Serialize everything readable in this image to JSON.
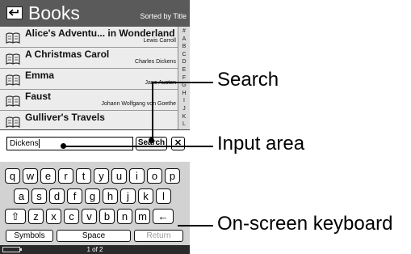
{
  "header": {
    "back_icon": "back-arrow-icon",
    "title": "Books",
    "sort_label": "Sorted by Title"
  },
  "books": [
    {
      "title": "Alice's Adventu... in Wonderland",
      "author": "Lewis Carroll"
    },
    {
      "title": "A Christmas Carol",
      "author": "Charles Dickens"
    },
    {
      "title": "Emma",
      "author": "Jane Austen"
    },
    {
      "title": "Faust",
      "author": "Johann Wolfgang von Goethe"
    },
    {
      "title": "Gulliver's Travels",
      "author": ""
    }
  ],
  "alphabet_index": [
    "#",
    "A",
    "B",
    "C",
    "D",
    "E",
    "F",
    "G",
    "H",
    "I",
    "J",
    "K",
    "L"
  ],
  "search": {
    "input_value": "Dickens",
    "button_label": "Search",
    "close_label": "✕"
  },
  "keyboard": {
    "row1": [
      "q",
      "w",
      "e",
      "r",
      "t",
      "y",
      "u",
      "i",
      "o",
      "p"
    ],
    "row2": [
      "a",
      "s",
      "d",
      "f",
      "g",
      "h",
      "j",
      "k",
      "l"
    ],
    "row3": [
      "⇧",
      "z",
      "x",
      "c",
      "v",
      "b",
      "n",
      "m",
      "←"
    ],
    "symbols_label": "Symbols",
    "space_label": "Space",
    "return_label": "Return"
  },
  "status": {
    "page_indicator": "1 of 2",
    "battery_icon": "battery-icon"
  },
  "callouts": {
    "search": "Search",
    "input_area": "Input area",
    "keyboard": "On-screen keyboard"
  }
}
